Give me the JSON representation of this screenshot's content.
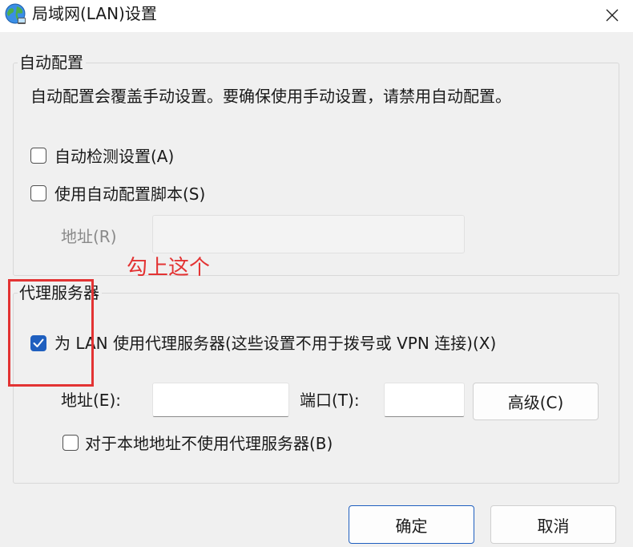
{
  "window": {
    "title": "局域网(LAN)设置",
    "close_glyph": "✕"
  },
  "auto_config": {
    "group_label": "自动配置",
    "description": "自动配置会覆盖手动设置。要确保使用手动设置，请禁用自动配置。",
    "auto_detect_label": "自动检测设置(A)",
    "auto_detect_checked": false,
    "use_script_label": "使用自动配置脚本(S)",
    "use_script_checked": false,
    "address_label": "地址(R)",
    "address_value": ""
  },
  "proxy": {
    "group_label": "代理服务器",
    "use_proxy_label": "为 LAN 使用代理服务器(这些设置不用于拨号或 VPN 连接)(X)",
    "use_proxy_checked": true,
    "address_label": "地址(E):",
    "address_value": "",
    "port_label": "端口(T):",
    "port_value": "",
    "advanced_button": "高级(C)",
    "bypass_local_label": "对于本地地址不使用代理服务器(B)",
    "bypass_local_checked": false
  },
  "buttons": {
    "ok": "确定",
    "cancel": "取消"
  },
  "annotation": {
    "text": "勾上这个",
    "color": "#e33333"
  },
  "colors": {
    "accent": "#1f5fbf",
    "annotation_red": "#e33333"
  },
  "icons": {
    "title_icon": "globe-network-icon"
  }
}
